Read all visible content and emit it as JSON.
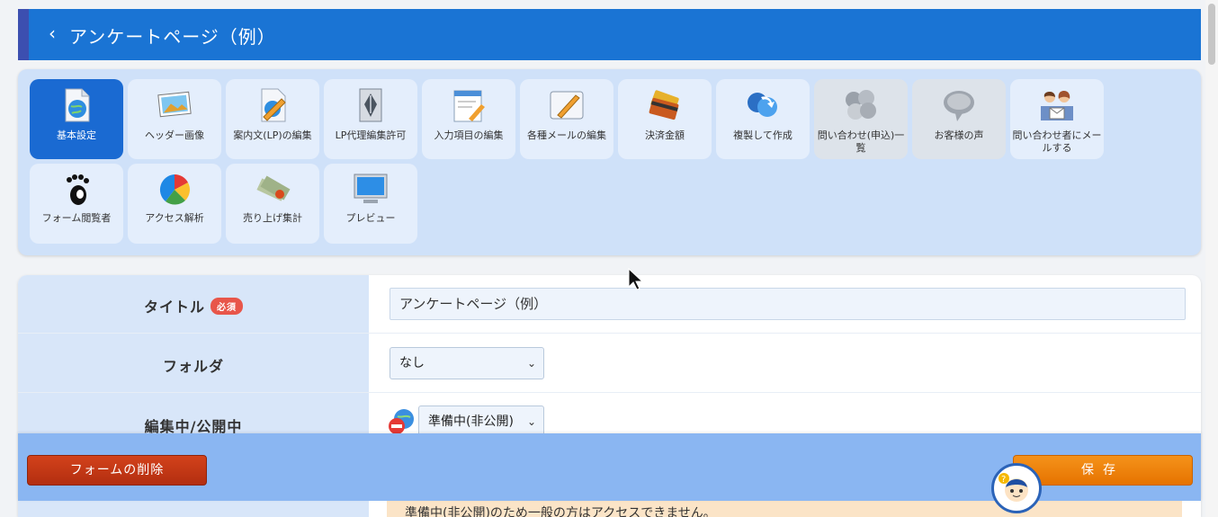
{
  "header": {
    "back_icon": "chevron-left-icon",
    "back_glyph": "‹",
    "title": "アンケートページ（例）"
  },
  "toolbar": {
    "items": [
      {
        "label": "基本設定",
        "icon": "globe-document-icon",
        "active": true
      },
      {
        "label": "ヘッダー画像",
        "icon": "picture-icon"
      },
      {
        "label": "案内文(LP)の編集",
        "icon": "pencil-document-icon"
      },
      {
        "label": "LP代理編集許可",
        "icon": "pen-nib-icon"
      },
      {
        "label": "入力項目の編集",
        "icon": "form-edit-icon"
      },
      {
        "label": "各種メールの編集",
        "icon": "mail-pencil-icon"
      },
      {
        "label": "決済金額",
        "icon": "credit-card-icon"
      },
      {
        "label": "複製して作成",
        "icon": "duplicate-arrows-icon"
      },
      {
        "label": "問い合わせ(申込)一覧",
        "icon": "inquiry-list-icon",
        "dim": true
      },
      {
        "label": "お客様の声",
        "icon": "speech-bubble-icon",
        "dim": true
      },
      {
        "label": "問い合わせ者にメールする",
        "icon": "people-mail-icon"
      },
      {
        "label": "フォーム閲覧者",
        "icon": "footprint-icon"
      },
      {
        "label": "アクセス解析",
        "icon": "pie-chart-icon"
      },
      {
        "label": "売り上げ集計",
        "icon": "money-stack-icon"
      },
      {
        "label": "プレビュー",
        "icon": "monitor-icon"
      }
    ]
  },
  "form": {
    "title_label": "タイトル",
    "required_badge": "必須",
    "title_value": "アンケートページ（例）",
    "folder_label": "フォルダ",
    "folder_value": "なし",
    "status_label": "編集中/公開中",
    "status_value": "準備中(非公開)",
    "status_icon": "unpublished-globe-icon",
    "notice": "準備中(非公開)のため一般の方はアクセスできません。"
  },
  "actions": {
    "delete_label": "フォームの削除",
    "save_label": "保存"
  },
  "colors": {
    "header": "#1a74d4",
    "toolbar_bg": "#cfe1f9",
    "active_tool": "#1a6ad2",
    "delete": "#c23a16",
    "save": "#f07f0b",
    "bottombar": "#8ab6f2"
  }
}
